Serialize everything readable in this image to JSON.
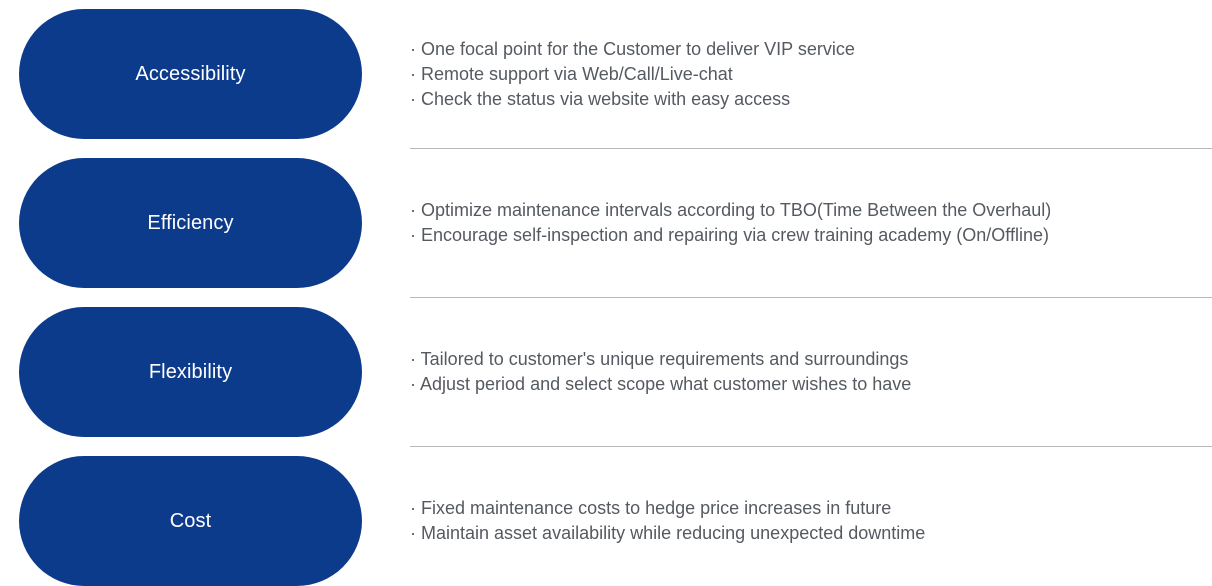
{
  "rows": [
    {
      "title": "Accessibility",
      "lines": [
        "· One focal point for the Customer to deliver VIP service",
        "· Remote support via Web/Call/Live-chat",
        "· Check the status via website with easy access"
      ]
    },
    {
      "title": "Efficiency",
      "lines": [
        "· Optimize maintenance intervals according to TBO(Time Between the Overhaul)",
        "· Encourage self-inspection and repairing via crew training academy (On/Offline)"
      ]
    },
    {
      "title": "Flexibility",
      "lines": [
        "· Tailored to customer's unique requirements and surroundings",
        "· Adjust period and select scope what customer wishes to have"
      ]
    },
    {
      "title": "Cost",
      "lines": [
        "· Fixed maintenance costs to hedge price increases in future",
        "· Maintain asset availability while reducing unexpected downtime"
      ]
    }
  ],
  "colors": {
    "pill": "#0d3b8c",
    "text": "#555a61",
    "divider": "#b8b8b8"
  }
}
